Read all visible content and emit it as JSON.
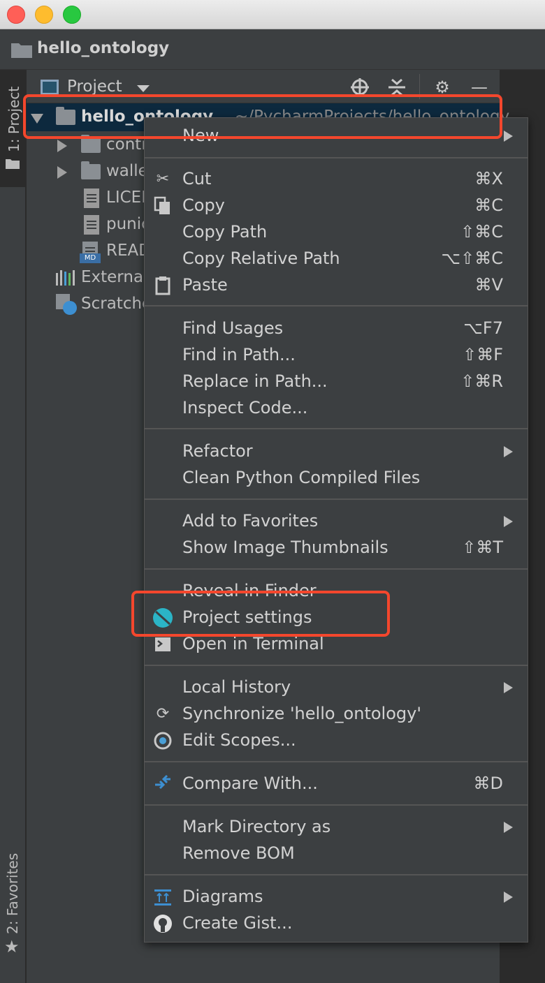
{
  "window": {
    "title": "hello_ontology"
  },
  "tool_strip": {
    "project_tab": "1: Project",
    "favorites_tab": "2: Favorites"
  },
  "panel": {
    "title": "Project"
  },
  "tree": {
    "root": {
      "name": "hello_ontology",
      "path": "~/PycharmProjects/hello_ontology"
    },
    "items": [
      {
        "name": "contracts",
        "type": "folder"
      },
      {
        "name": "wallets",
        "type": "folder"
      },
      {
        "name": "LICENSE",
        "type": "file"
      },
      {
        "name": "punica.json",
        "type": "json"
      },
      {
        "name": "README.md",
        "type": "md"
      }
    ],
    "external": "External Libraries",
    "scratches": "Scratches and Consoles"
  },
  "menu": {
    "new": "New",
    "cut": {
      "label": "Cut",
      "shortcut": "⌘X"
    },
    "copy": {
      "label": "Copy",
      "shortcut": "⌘C"
    },
    "copy_path": {
      "label": "Copy Path",
      "shortcut": "⇧⌘C"
    },
    "copy_relative_path": {
      "label": "Copy Relative Path",
      "shortcut": "⌥⇧⌘C"
    },
    "paste": {
      "label": "Paste",
      "shortcut": "⌘V"
    },
    "find_usages": {
      "label": "Find Usages",
      "shortcut": "⌥F7"
    },
    "find_in_path": {
      "label": "Find in Path...",
      "shortcut": "⇧⌘F"
    },
    "replace_in_path": {
      "label": "Replace in Path...",
      "shortcut": "⇧⌘R"
    },
    "inspect_code": "Inspect Code...",
    "refactor": "Refactor",
    "clean_python": "Clean Python Compiled Files",
    "add_favorites": "Add to Favorites",
    "show_thumbnails": {
      "label": "Show Image Thumbnails",
      "shortcut": "⇧⌘T"
    },
    "reveal_finder": "Reveal in Finder",
    "project_settings": "Project settings",
    "open_terminal": "Open in Terminal",
    "local_history": "Local History",
    "synchronize": "Synchronize 'hello_ontology'",
    "edit_scopes": "Edit Scopes...",
    "compare_with": {
      "label": "Compare With...",
      "shortcut": "⌘D"
    },
    "mark_directory": "Mark Directory as",
    "remove_bom": "Remove BOM",
    "diagrams": "Diagrams",
    "create_gist": "Create Gist..."
  },
  "colors": {
    "highlight": "#f4472d",
    "accent_ontology": "#2bb4c6",
    "selection": "#0d293e"
  }
}
